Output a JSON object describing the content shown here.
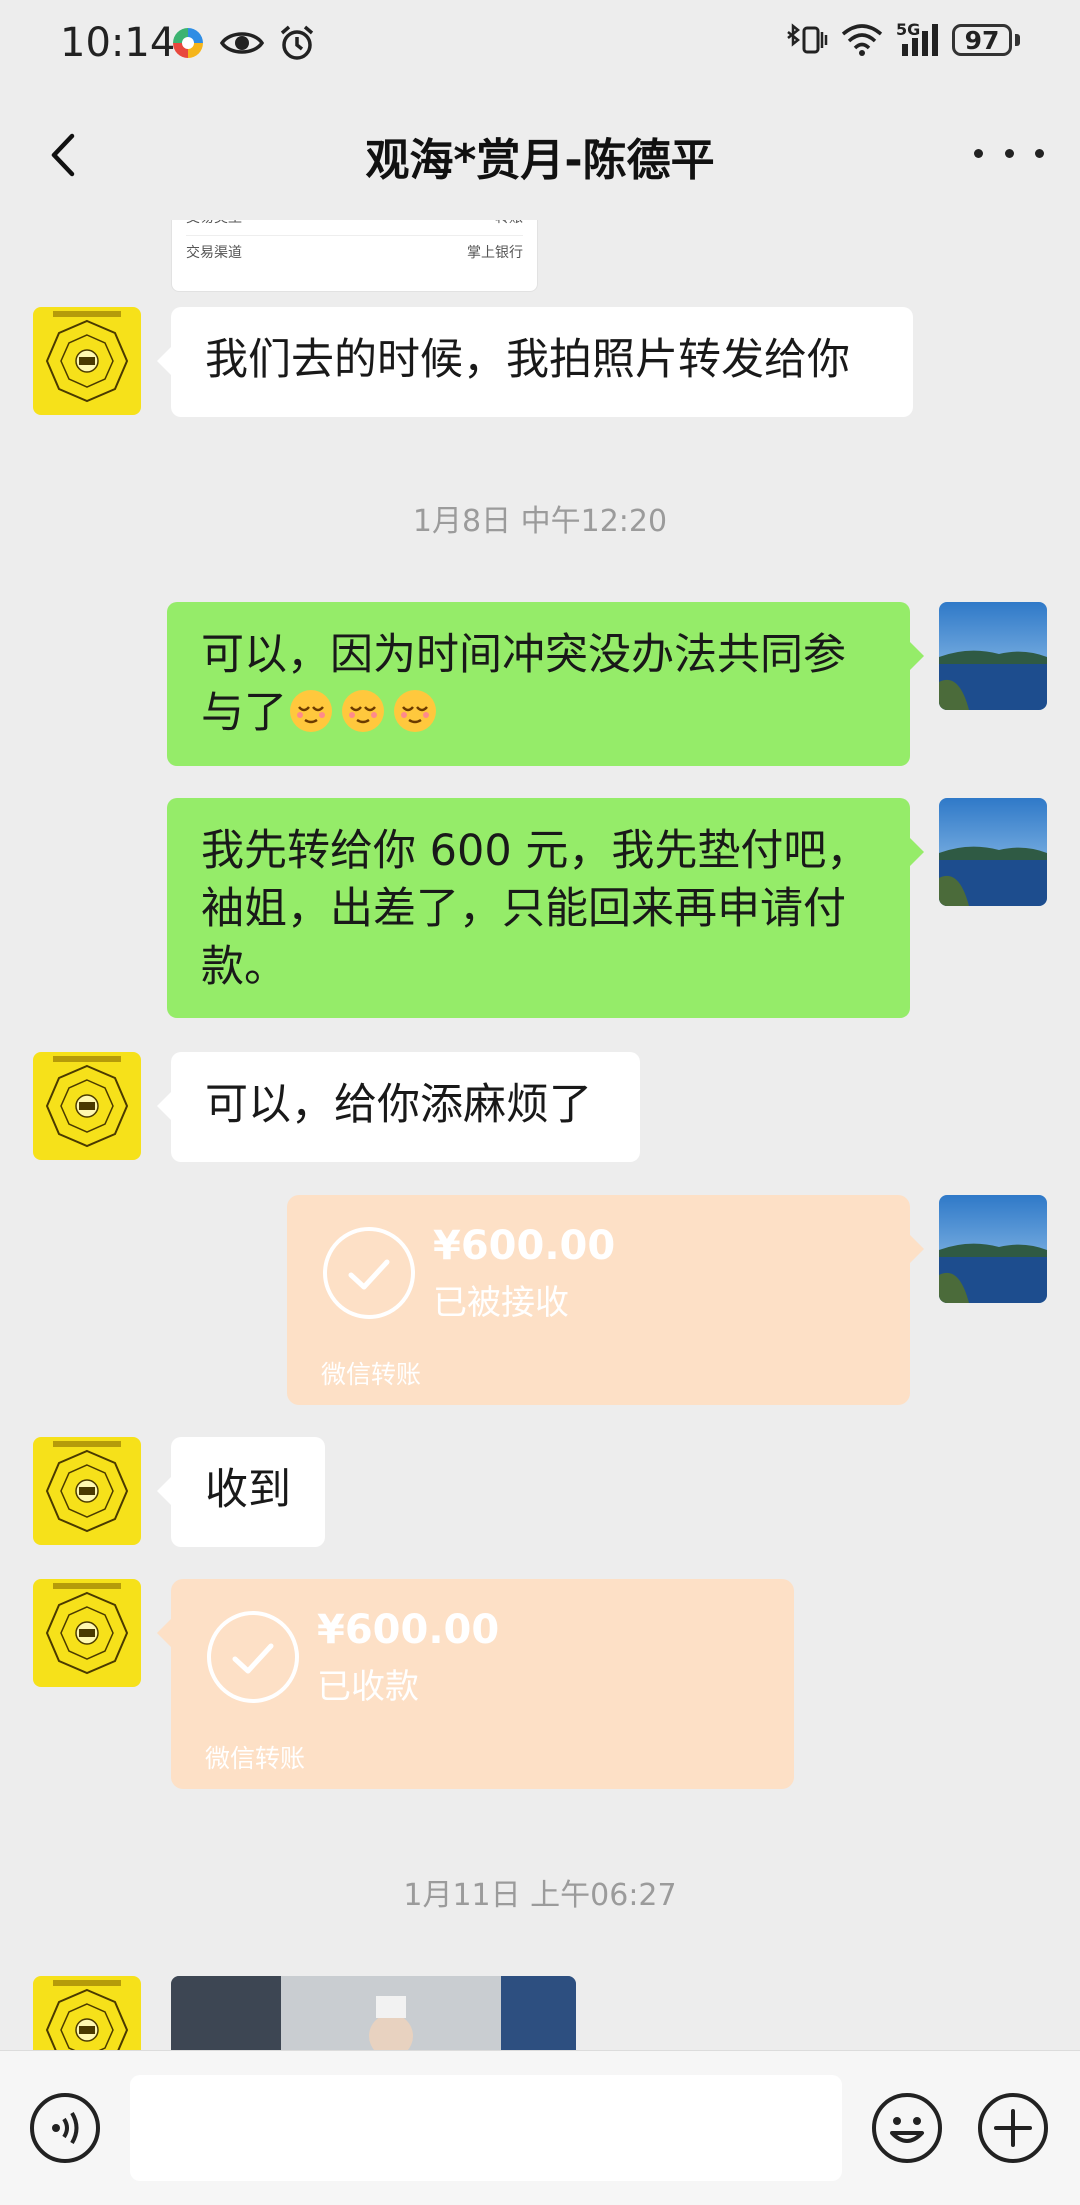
{
  "status_bar": {
    "time": "10:14",
    "network": "5G",
    "battery": "97"
  },
  "header": {
    "title": "观海*赏月-陈德平"
  },
  "receipt_card": {
    "rows": [
      {
        "label": "交易类型",
        "value": "转账"
      },
      {
        "label": "交易渠道",
        "value": "掌上银行"
      }
    ]
  },
  "messages": {
    "m1": {
      "text": "我们去的时候，我拍照片转发给你"
    },
    "ts1": {
      "text": "1月8日 中午12:20"
    },
    "m2": {
      "text": "可以，因为时间冲突没办法共同参与了"
    },
    "m3": {
      "text": "我先转给你 600 元，我先垫付吧，袖姐，出差了，只能回来再申请付款。"
    },
    "m4": {
      "text": "可以，给你添麻烦了"
    },
    "t1": {
      "amount": "¥600.00",
      "status": "已被接收",
      "footer": "微信转账"
    },
    "m5": {
      "text": "收到"
    },
    "t2": {
      "amount": "¥600.00",
      "status": "已收款",
      "footer": "微信转账"
    },
    "ts2": {
      "text": "1月11日 上午06:27"
    }
  },
  "colors": {
    "sent_bubble": "#95ec69",
    "received_bubble": "#ffffff",
    "transfer_bubble": "#fde0c6",
    "background": "#ededed"
  },
  "icons": {
    "back": "chevron-left-icon",
    "more": "more-dots-icon",
    "voice": "voice-icon",
    "emoji": "emoji-icon",
    "plus": "plus-icon"
  },
  "input": {
    "value": ""
  }
}
